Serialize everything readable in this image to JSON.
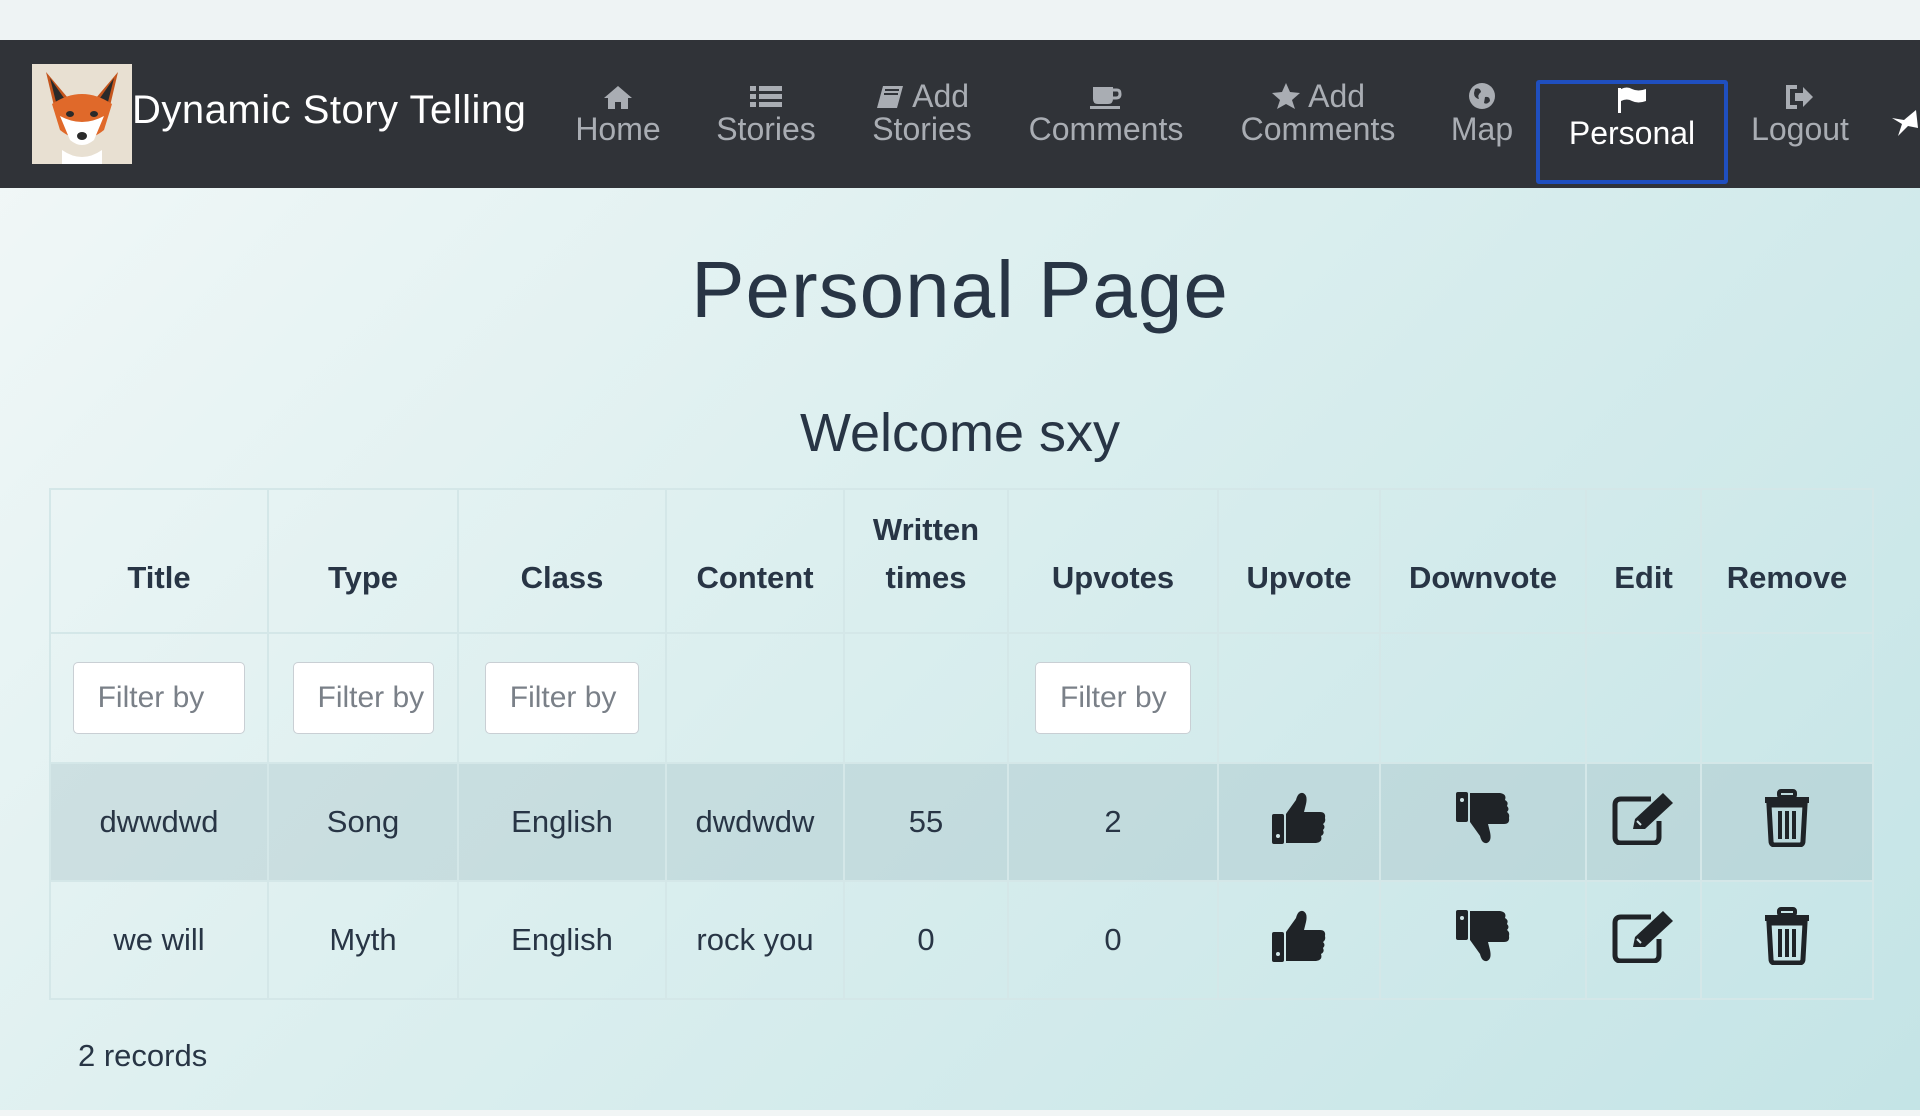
{
  "app": {
    "brand_title": "Dynamic Story Telling",
    "logo_icon": "fox-logo-icon"
  },
  "nav": {
    "home": {
      "l1": "",
      "l2": "Home",
      "icon": "home-icon"
    },
    "stories": {
      "l1": "",
      "l2": "Stories",
      "icon": "list-icon"
    },
    "add_stories": {
      "l1": "Add",
      "l2": "Stories",
      "icon": "book-icon"
    },
    "comments": {
      "l1": "",
      "l2": "Comments",
      "icon": "coffee-icon"
    },
    "add_comments": {
      "l1": "Add",
      "l2": "Comments",
      "icon": "star-icon"
    },
    "map": {
      "l1": "",
      "l2": "Map",
      "icon": "globe-icon"
    },
    "personal": {
      "l1": "",
      "l2": "Personal",
      "icon": "flag-icon",
      "active": true
    },
    "logout": {
      "l1": "",
      "l2": "Logout",
      "icon": "logout-icon"
    }
  },
  "page": {
    "title": "Personal Page",
    "welcome": "Welcome sxy"
  },
  "table": {
    "headers": {
      "title": "Title",
      "type": "Type",
      "class": "Class",
      "content": "Content",
      "written_times_1": "Written",
      "written_times_2": "times",
      "upvotes": "Upvotes",
      "upvote": "Upvote",
      "downvote": "Downvote",
      "edit": "Edit",
      "remove": "Remove"
    },
    "filters": {
      "title": "Filter by",
      "type": "Filter by",
      "class": "Filter by",
      "upvotes": "Filter by"
    },
    "rows": [
      {
        "title": "dwwdwd",
        "type": "Song",
        "class": "English",
        "content": "dwdwdw",
        "written_times": "55",
        "upvotes": "2"
      },
      {
        "title": "we will",
        "type": "Myth",
        "class": "English",
        "content": "rock you",
        "written_times": "0",
        "upvotes": "0"
      }
    ]
  },
  "footer": {
    "records": "2 records"
  },
  "colors": {
    "navbar": "#303338",
    "active_border": "#1f4fbf",
    "text": "#283545"
  }
}
